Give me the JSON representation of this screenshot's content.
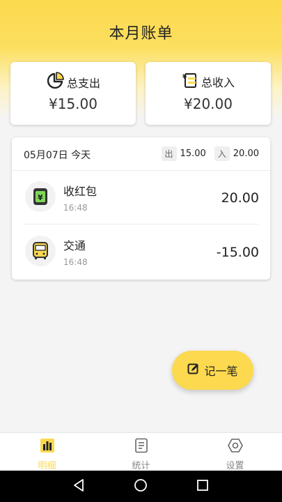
{
  "header": {
    "title": "本月账单"
  },
  "summary": {
    "expense": {
      "label": "总支出",
      "amount": "¥15.00",
      "icon": "pie-chart-icon"
    },
    "income": {
      "label": "总收入",
      "amount": "¥20.00",
      "icon": "ledger-yen-icon"
    }
  },
  "day": {
    "date": "05月07日 今天",
    "out_tag": "出",
    "out_total": "15.00",
    "in_tag": "入",
    "in_total": "20.00",
    "transactions": [
      {
        "name": "收红包",
        "time": "16:48",
        "amount": "20.00",
        "icon": "red-envelope-icon"
      },
      {
        "name": "交通",
        "time": "16:48",
        "amount": "-15.00",
        "icon": "bus-icon"
      }
    ]
  },
  "fab": {
    "label": "记一笔",
    "icon": "edit-icon"
  },
  "tabs": [
    {
      "label": "明细",
      "icon": "bar-chart-icon",
      "active": true
    },
    {
      "label": "统计",
      "icon": "document-icon",
      "active": false
    },
    {
      "label": "设置",
      "icon": "settings-icon",
      "active": false
    }
  ],
  "colors": {
    "accent": "#fcd94e",
    "background": "#f5f4f5",
    "card": "#ffffff"
  }
}
